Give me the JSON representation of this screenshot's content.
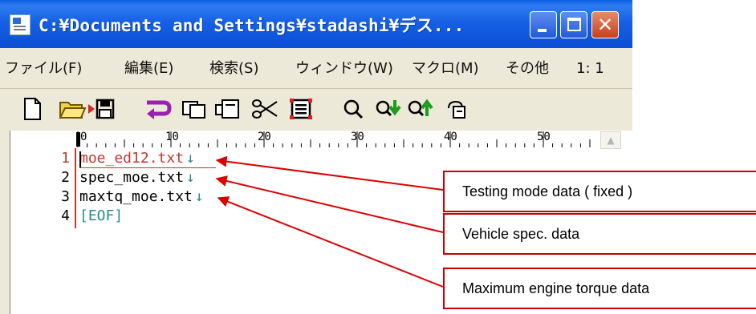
{
  "window": {
    "title": "C:¥Documents and Settings¥stadashi¥デス...",
    "minimize_icon": "minimize-icon",
    "maximize_icon": "maximize-icon",
    "close_icon": "close-icon",
    "close_glyph": "✕",
    "title_bar_color": "#0a5fe4"
  },
  "menu": {
    "items": [
      "ファイル(F)",
      "編集(E)",
      "検索(S)",
      "ウィンドウ(W)",
      "マクロ(M)",
      "その他",
      "1: 1"
    ]
  },
  "toolbar": {
    "icons": [
      "new-file-icon",
      "open-folder-icon",
      "save-icon",
      "undo-icon",
      "copy-icon",
      "cut-icon",
      "paste-icon",
      "search-icon",
      "find-next-icon",
      "find-previous-icon",
      "grep-icon"
    ]
  },
  "editor": {
    "ruler_labels": [
      "0",
      "10",
      "20",
      "30",
      "40",
      "50"
    ],
    "lines": [
      {
        "number": "1",
        "text": "moe_ed12.txt",
        "eol": "↓"
      },
      {
        "number": "2",
        "text": "spec_moe.txt",
        "eol": "↓"
      },
      {
        "number": "3",
        "text": "maxtq_moe.txt",
        "eol": "↓"
      },
      {
        "number": "4",
        "text": "[EOF]",
        "eol": ""
      }
    ],
    "scroll_up_glyph": "▲"
  },
  "callouts": [
    {
      "text": "Testing mode data ( fixed )"
    },
    {
      "text": "Vehicle spec. data"
    },
    {
      "text": "Maximum engine torque data"
    }
  ],
  "colors": {
    "callout_border": "#cc0000",
    "arrow": "#dd0000",
    "current_line": "#c0392b",
    "eol_mark": "#2a8a8a"
  }
}
